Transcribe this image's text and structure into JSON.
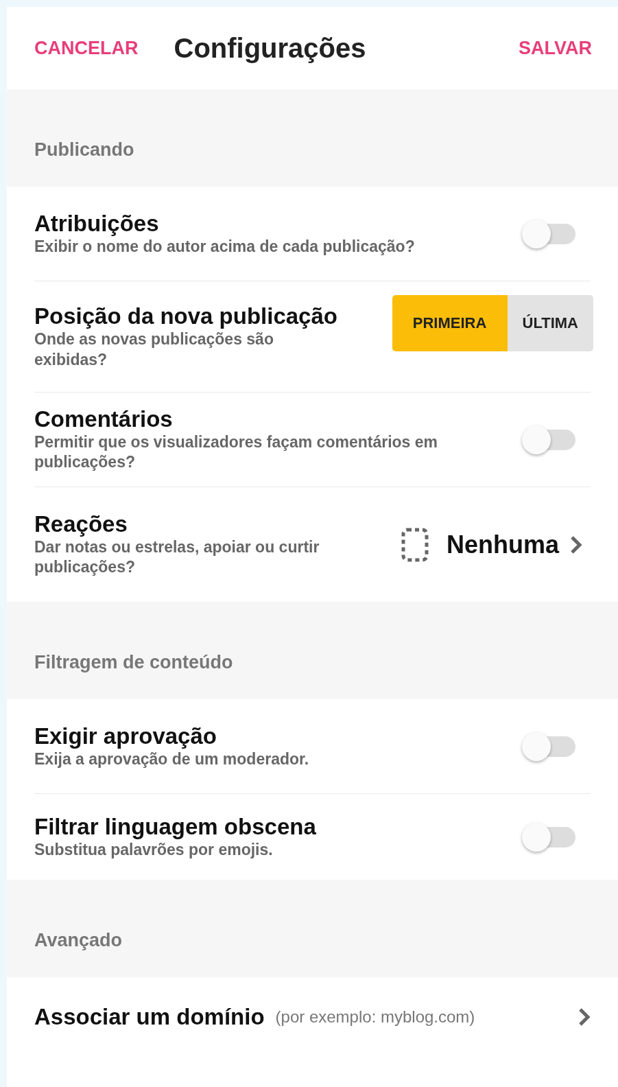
{
  "header": {
    "cancel": "CANCELAR",
    "title": "Configurações",
    "save": "SALVAR"
  },
  "sections": [
    {
      "title": "Publicando",
      "items": [
        {
          "kind": "toggle",
          "title": "Atribuições",
          "subtitle": "Exibir o nome do autor acima de cada publicação?",
          "on": false
        },
        {
          "kind": "segmented",
          "title": "Posição da nova publicação",
          "subtitle": "Onde as novas publicações são exibidas?",
          "options": [
            {
              "label": "PRIMEIRA",
              "selected": true
            },
            {
              "label": "ÚLTIMA",
              "selected": false
            }
          ]
        },
        {
          "kind": "toggle",
          "title": "Comentários",
          "subtitle": "Permitir que os visualizadores façam comentários em publicações?",
          "on": false
        },
        {
          "kind": "choice",
          "title": "Reações",
          "subtitle": "Dar notas ou estrelas, apoiar ou curtir publicações?",
          "value": "Nenhuma"
        }
      ]
    },
    {
      "title": "Filtragem de conteúdo",
      "items": [
        {
          "kind": "toggle",
          "title": "Exigir aprovação",
          "subtitle": "Exija a aprovação de um moderador.",
          "on": false
        },
        {
          "kind": "toggle",
          "title": "Filtrar linguagem obscena",
          "subtitle": "Substitua palavrões por emojis.",
          "on": false
        }
      ]
    },
    {
      "title": "Avançado",
      "items": [
        {
          "kind": "link",
          "title": "Associar um domínio",
          "hint": "(por exemplo: myblog.com)"
        }
      ]
    }
  ]
}
